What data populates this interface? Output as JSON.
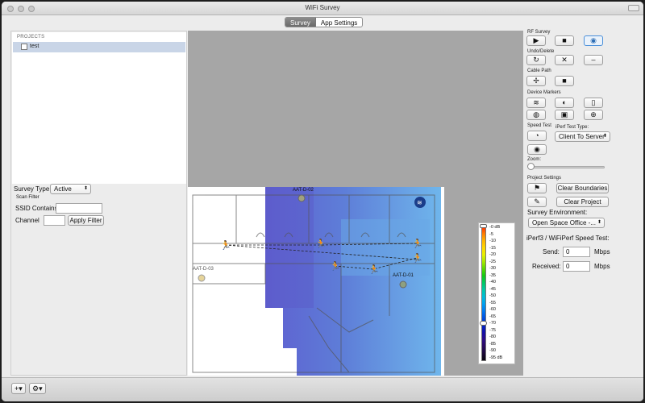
{
  "window": {
    "title": "WiFi Survey"
  },
  "tabs": [
    {
      "label": "Survey",
      "selected": true
    },
    {
      "label": "App Settings",
      "selected": false
    }
  ],
  "projects": {
    "header": "PROJECTS",
    "items": [
      {
        "name": "test",
        "selected": true
      }
    ]
  },
  "left": {
    "survey_type_label": "Survey Type:",
    "survey_type_value": "Active",
    "scan_filter_label": "Scan Filter",
    "ssid_label": "SSID Contains",
    "ssid_value": "",
    "channel_label": "Channel",
    "channel_value": "",
    "apply_filter": "Apply Filter"
  },
  "map": {
    "access_points": [
      {
        "label": "AAT-D-02"
      },
      {
        "label": "AAT-D-03"
      },
      {
        "label": "AAT-D-01"
      }
    ],
    "legend": {
      "labels": [
        "-0 dB",
        "-5",
        "-10",
        "-15",
        "-20",
        "-25",
        "-30",
        "-35",
        "-40",
        "-45",
        "-50",
        "-55",
        "-60",
        "-65",
        "-70",
        "-75",
        "-80",
        "-85",
        "-90",
        "-95 dB"
      ],
      "colors": [
        "#ff2a00",
        "#ff7a00",
        "#ffb400",
        "#ffd800",
        "#e6f000",
        "#a8e800",
        "#5ad800",
        "#14c814",
        "#00c864",
        "#00c8a8",
        "#00bcd8",
        "#00a0f0",
        "#0078f0",
        "#0050e0",
        "#0028c8",
        "#1410a8",
        "#2c0c88",
        "#2a0a60",
        "#1a0838",
        "#080410"
      ],
      "slider_value": "-70"
    }
  },
  "right": {
    "rf_survey": "RF Survey",
    "undo_delete": "Undo/Delete",
    "cable_path": "Cable Path",
    "device_markers": "Device Markers",
    "speed_test": "Speed Test",
    "iperf_test_type_label": "iPerf Test Type:",
    "iperf_test_type_value": "Client To Server",
    "zoom_label": "Zoom:",
    "zoom_value": 0,
    "project_settings": "Project Settings",
    "clear_boundaries": "Clear Boundaries",
    "clear_project": "Clear Project",
    "survey_env_label": "Survey Environment:",
    "survey_env_value": "Open Space Office -...",
    "iperf_label": "iPerf3 / WiFiPerf Speed Test:",
    "send_label": "Send:",
    "send_value": "0",
    "send_unit": "Mbps",
    "received_label": "Received:",
    "received_value": "0",
    "received_unit": "Mbps"
  },
  "bottom": {
    "add_label": "+",
    "gear_label": "⚙"
  }
}
